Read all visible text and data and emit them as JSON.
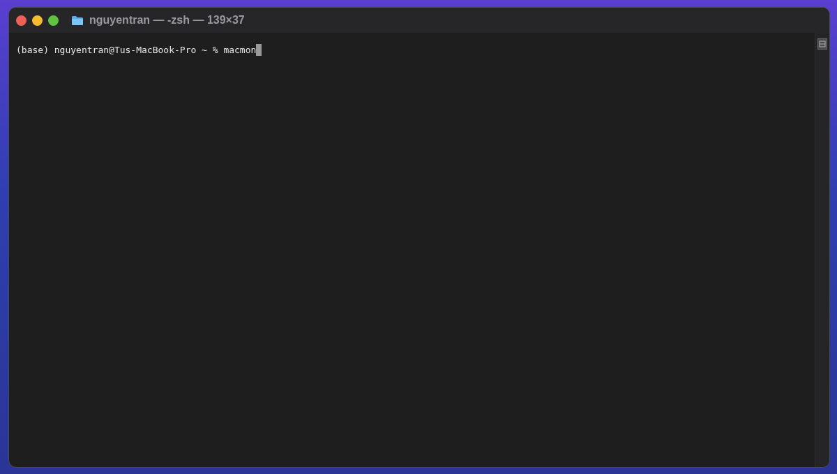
{
  "window": {
    "title": "nguyentran — -zsh — 139×37"
  },
  "terminal": {
    "lines": [
      {
        "prompt": "(base) nguyentran@Tus-MacBook-Pro ~ %",
        "command": "macmon",
        "cursor": true
      }
    ]
  }
}
